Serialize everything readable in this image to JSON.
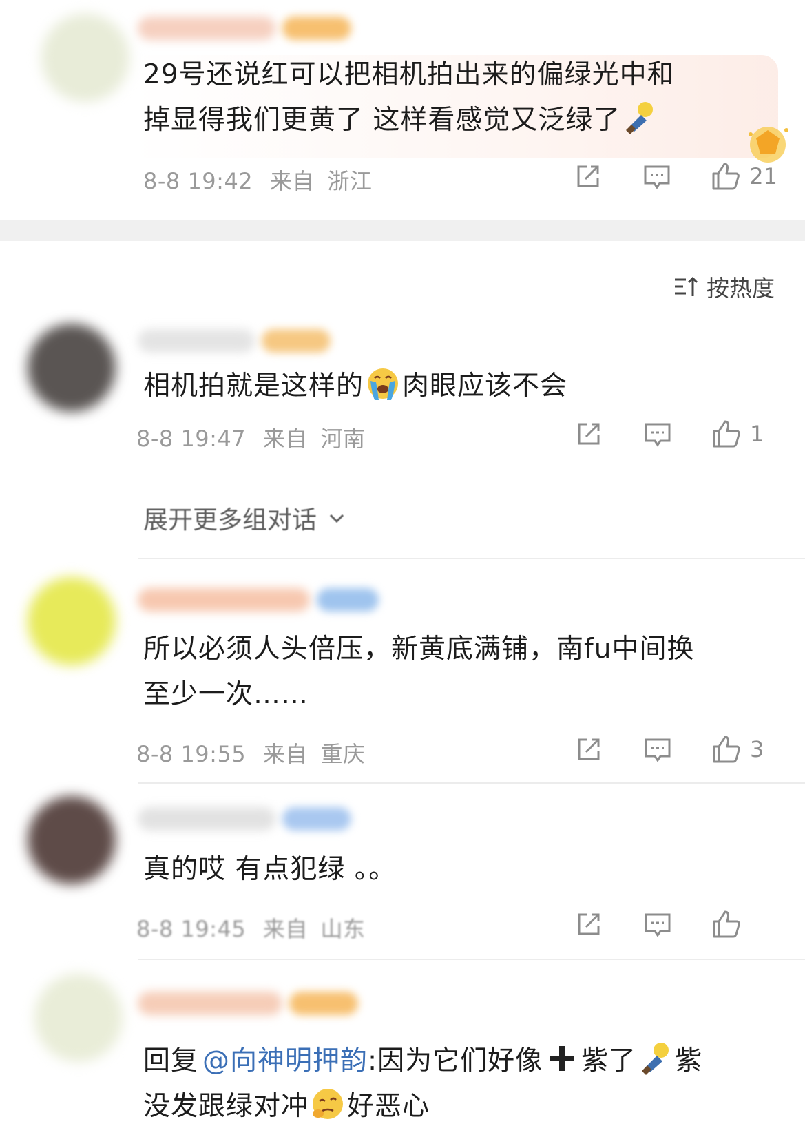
{
  "sort": {
    "label": "按热度"
  },
  "expand": {
    "label": "展开更多组对话"
  },
  "comments": [
    {
      "text_line1": "29号还说红可以把相机拍出来的偏绿光中和",
      "text_line2": "掉显得我们更黄了 这样看感觉又泛绿了",
      "date": "8-8 19:42",
      "from_label": "来自",
      "location": "浙江",
      "likes": "21"
    },
    {
      "text_before": "相机拍就是这样的",
      "text_after": "肉眼应该不会",
      "date": "8-8 19:47",
      "from_label": "来自",
      "location": "河南",
      "likes": "1"
    },
    {
      "text_line1": "所以必须人头倍压，新黄底满铺，南fu中间换",
      "text_line2": "至少一次……",
      "date": "8-8 19:55",
      "from_label": "来自",
      "location": "重庆",
      "likes": "3"
    },
    {
      "text": "真的哎 有点犯绿 。。",
      "date": "8-8 19:45",
      "from_label": "来自",
      "location": "山东",
      "likes": ""
    },
    {
      "reply_prefix": "回复",
      "mention": "@向神明押韵",
      "text_a": ":因为它们好像",
      "text_b": "紫了",
      "text_c": "紫",
      "text_line2_a": "没发跟绿对冲",
      "text_line2_b": "好恶心"
    }
  ],
  "icons": {
    "share": "share-icon",
    "comment": "comment-icon",
    "like": "thumbs-up-icon",
    "sort": "sort-icon",
    "chevron": "chevron-down-icon"
  },
  "colors": {
    "meta_gray": "#9a9a9a",
    "mention_blue": "#3b6fb6",
    "divider": "#f0f0f0"
  }
}
